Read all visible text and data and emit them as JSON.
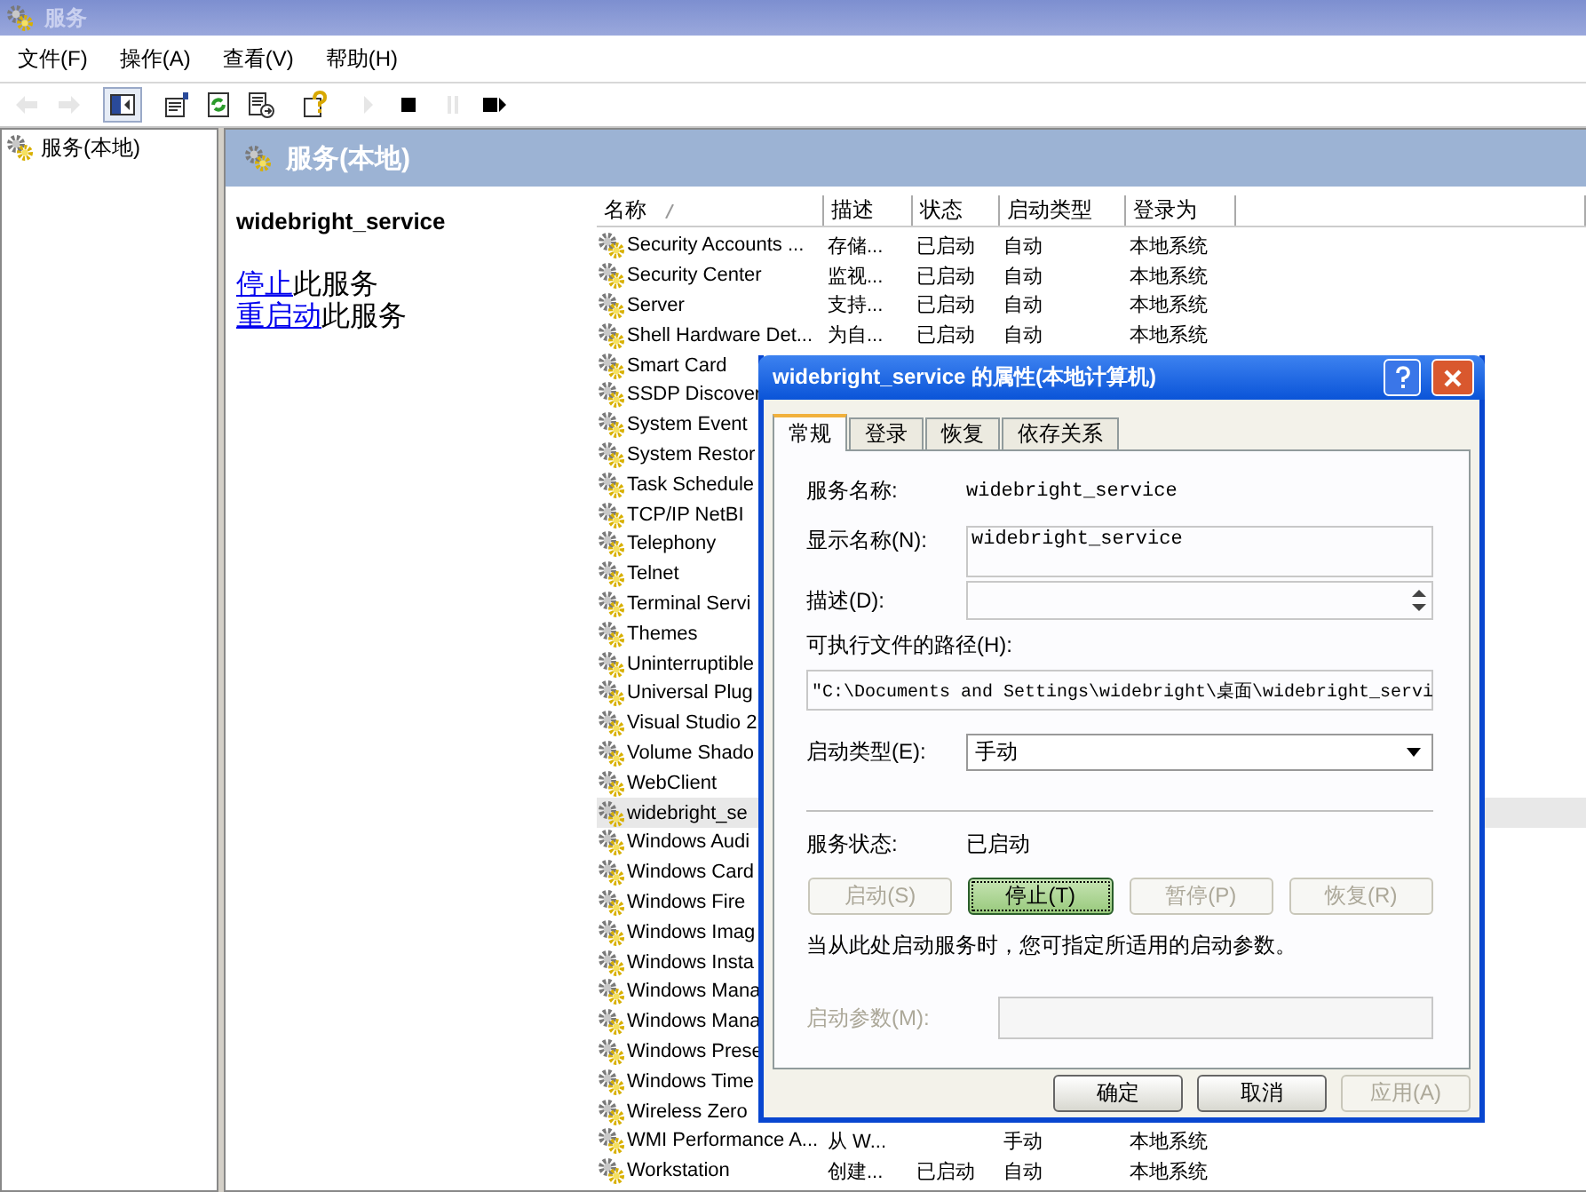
{
  "window": {
    "title": "服务"
  },
  "menu": [
    "文件(F)",
    "操作(A)",
    "查看(V)",
    "帮助(H)"
  ],
  "toolbar": [
    {
      "kind": "back",
      "disabled": true,
      "pressed": false
    },
    {
      "kind": "forward",
      "disabled": true,
      "pressed": false
    },
    {
      "kind": "tree",
      "disabled": false,
      "pressed": true
    },
    {
      "kind": "properties",
      "disabled": false,
      "pressed": false
    },
    {
      "kind": "refresh",
      "disabled": false,
      "pressed": false
    },
    {
      "kind": "export",
      "disabled": false,
      "pressed": false
    },
    {
      "kind": "help",
      "disabled": false,
      "pressed": false
    },
    {
      "kind": "play",
      "disabled": true,
      "pressed": false
    },
    {
      "kind": "stop",
      "disabled": false,
      "pressed": false
    },
    {
      "kind": "pause",
      "disabled": true,
      "pressed": false
    },
    {
      "kind": "restart",
      "disabled": false,
      "pressed": false
    }
  ],
  "tree": {
    "items": [
      {
        "label": "服务(本地)"
      }
    ]
  },
  "pane": {
    "title": "服务(本地)",
    "service_name": "widebright_service",
    "actions": [
      {
        "link": "停止",
        "text": "此服务"
      },
      {
        "link": "重启动",
        "text": "此服务"
      }
    ]
  },
  "table": {
    "columns": [
      {
        "label": "名称",
        "sorted": true
      },
      {
        "label": "描述",
        "sorted": false
      },
      {
        "label": "状态",
        "sorted": false
      },
      {
        "label": "启动类型",
        "sorted": false
      },
      {
        "label": "登录为",
        "sorted": false
      }
    ],
    "rows": [
      {
        "name": "Security Accounts ...",
        "description": "存储...",
        "status": "已启动",
        "startup_type": "自动",
        "log_on_as": "本地系统",
        "selected": false
      },
      {
        "name": "Security Center",
        "description": "监视...",
        "status": "已启动",
        "startup_type": "自动",
        "log_on_as": "本地系统",
        "selected": false
      },
      {
        "name": "Server",
        "description": "支持...",
        "status": "已启动",
        "startup_type": "自动",
        "log_on_as": "本地系统",
        "selected": false
      },
      {
        "name": "Shell Hardware Det...",
        "description": "为自...",
        "status": "已启动",
        "startup_type": "自动",
        "log_on_as": "本地系统",
        "selected": false
      },
      {
        "name": "Smart Card",
        "selected": false
      },
      {
        "name": "SSDP Discover",
        "selected": false
      },
      {
        "name": "System Event",
        "selected": false
      },
      {
        "name": "System Restor",
        "selected": false
      },
      {
        "name": "Task Schedule",
        "selected": false
      },
      {
        "name": "TCP/IP NetBI",
        "selected": false
      },
      {
        "name": "Telephony",
        "selected": false
      },
      {
        "name": "Telnet",
        "selected": false
      },
      {
        "name": "Terminal Servi",
        "selected": false
      },
      {
        "name": "Themes",
        "selected": false
      },
      {
        "name": "Uninterruptible",
        "selected": false
      },
      {
        "name": "Universal Plug",
        "selected": false
      },
      {
        "name": "Visual Studio 2",
        "selected": false
      },
      {
        "name": "Volume Shado",
        "selected": false
      },
      {
        "name": "WebClient",
        "selected": false
      },
      {
        "name": "widebright_se",
        "selected": true
      },
      {
        "name": "Windows Audi",
        "selected": false
      },
      {
        "name": "Windows Card",
        "selected": false
      },
      {
        "name": "Windows Fire",
        "selected": false
      },
      {
        "name": "Windows Imag",
        "selected": false
      },
      {
        "name": "Windows Insta",
        "selected": false
      },
      {
        "name": "Windows Mana",
        "selected": false
      },
      {
        "name": "Windows Mana",
        "selected": false
      },
      {
        "name": "Windows Prese",
        "selected": false
      },
      {
        "name": "Windows Time",
        "selected": false
      },
      {
        "name": "Wireless Zero",
        "selected": false
      },
      {
        "name": "WMI Performance A...",
        "description": "从 W...",
        "startup_type": "手动",
        "log_on_as": "本地系统",
        "selected": false
      },
      {
        "name": "Workstation",
        "description": "创建...",
        "status": "已启动",
        "startup_type": "自动",
        "log_on_as": "本地系统",
        "selected": false
      }
    ]
  },
  "dialog": {
    "title": "widebright_service 的属性(本地计算机)",
    "tabs": [
      {
        "label": "常规",
        "selected": true
      },
      {
        "label": "登录",
        "selected": false
      },
      {
        "label": "恢复",
        "selected": false
      },
      {
        "label": "依存关系",
        "selected": false
      }
    ],
    "service_name": {
      "label": "服务名称:",
      "value": "widebright_service"
    },
    "display_name": {
      "label": "显示名称(N):",
      "value": "widebright_service"
    },
    "description": {
      "label": "描述(D):"
    },
    "path": {
      "label": "可执行文件的路径(H):",
      "value": "\"C:\\Documents and Settings\\widebright\\桌面\\widebright_servi"
    },
    "startup_type": {
      "label": "启动类型(E):",
      "value": "手动"
    },
    "status": {
      "label": "服务状态:",
      "value": "已启动"
    },
    "service_buttons": [
      {
        "label": "启动(S)",
        "disabled": true,
        "focused": false
      },
      {
        "label": "停止(T)",
        "disabled": false,
        "focused": true
      },
      {
        "label": "暂停(P)",
        "disabled": true,
        "focused": false
      },
      {
        "label": "恢复(R)",
        "disabled": true,
        "focused": false
      }
    ],
    "hint": "当从此处启动服务时，您可指定所适用的启动参数。",
    "start_params": {
      "label": "启动参数(M):",
      "disabled": true
    },
    "buttons": [
      {
        "label": "确定",
        "disabled": false
      },
      {
        "label": "取消",
        "disabled": false
      },
      {
        "label": "应用(A)",
        "disabled": true
      }
    ]
  }
}
